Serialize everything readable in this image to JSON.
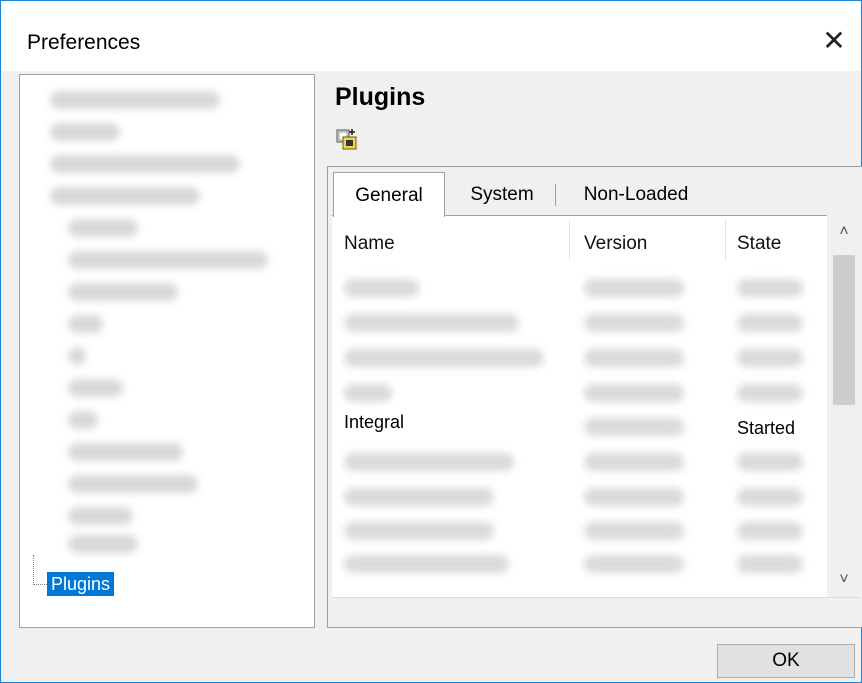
{
  "window": {
    "title": "Preferences",
    "close_glyph": "✕"
  },
  "tree": {
    "selected_item": "Plugins"
  },
  "panel": {
    "title": "Plugins",
    "toolbar_icon": "add-plugin-icon"
  },
  "tabs": [
    "General",
    "System",
    "Non-Loaded"
  ],
  "table": {
    "columns": [
      "Name",
      "Version",
      "State"
    ],
    "visible_row": {
      "name": "Integral",
      "state": "Started"
    }
  },
  "scroll": {
    "up": "˄",
    "down": "˅"
  },
  "footer": {
    "ok_label": "OK"
  }
}
